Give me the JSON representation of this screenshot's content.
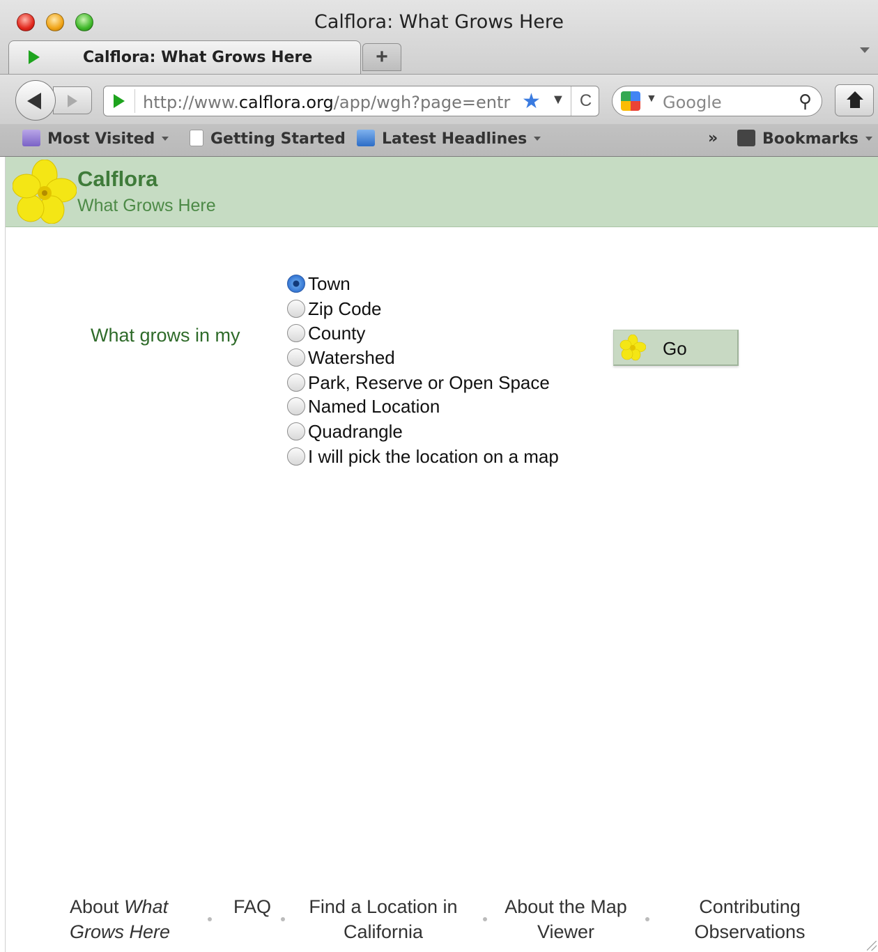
{
  "window": {
    "title": "Calflora: What Grows Here",
    "tab_label": "Calflora: What Grows Here",
    "new_tab_label": "+"
  },
  "navbar": {
    "url_prefix": "http://www.",
    "url_domain": "calflora.org",
    "url_path": "/app/wgh?page=entr",
    "search_placeholder": "Google",
    "reload_glyph": "C"
  },
  "bookmarks": {
    "items": [
      {
        "label": "Most Visited",
        "icon": "most-visited-icon"
      },
      {
        "label": "Getting Started",
        "icon": "page-icon"
      },
      {
        "label": "Latest Headlines",
        "icon": "rss-icon"
      }
    ],
    "overflow": "»",
    "bookmarks_label": "Bookmarks"
  },
  "header": {
    "title": "Calflora",
    "subtitle": "What Grows Here"
  },
  "form": {
    "prompt": "What grows in my",
    "options": [
      {
        "label": "Town",
        "checked": true
      },
      {
        "label": "Zip Code",
        "checked": false
      },
      {
        "label": "County",
        "checked": false
      },
      {
        "label": "Watershed",
        "checked": false
      },
      {
        "label": "Park, Reserve or Open Space",
        "checked": false
      },
      {
        "label": "Named Location",
        "checked": false
      },
      {
        "label": "Quadrangle",
        "checked": false
      },
      {
        "label": "I will pick the location on a map",
        "checked": false
      }
    ],
    "go_label": "Go"
  },
  "footer": {
    "about_pre": "About ",
    "about_em_1": "What",
    "about_em_2": "Grows Here",
    "faq": "FAQ",
    "find_1": "Find a Location in",
    "find_2": "California",
    "map_1": "About the Map",
    "map_2": "Viewer",
    "contrib_1": "Contributing",
    "contrib_2": "Observations"
  },
  "colors": {
    "header_bg": "#c6dcc3",
    "brand_green": "#3f7b3a",
    "go_button_bg": "#c8d9c3"
  }
}
